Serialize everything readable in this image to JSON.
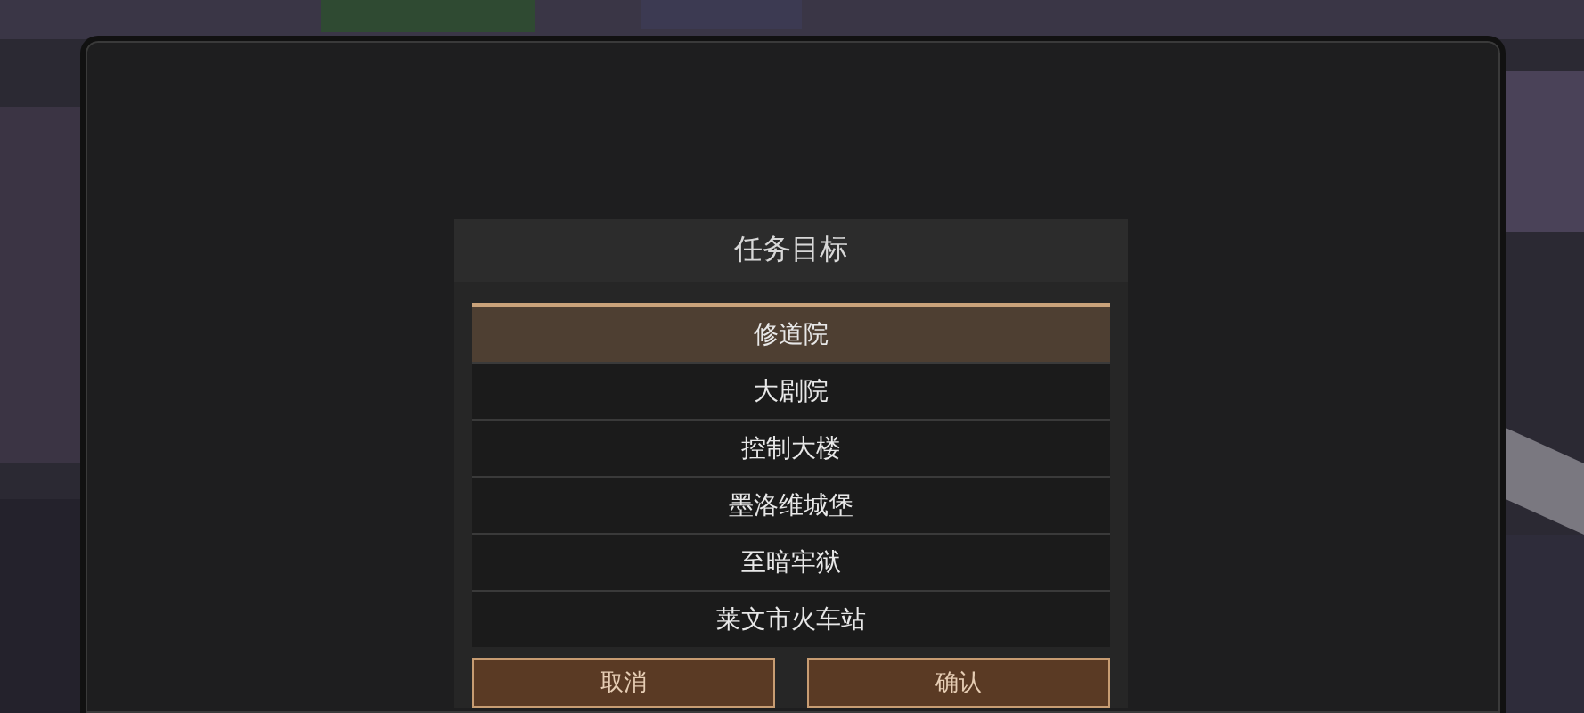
{
  "dialog": {
    "title": "任务目标",
    "options": [
      {
        "label": "修道院",
        "selected": true
      },
      {
        "label": "大剧院",
        "selected": false
      },
      {
        "label": "控制大楼",
        "selected": false
      },
      {
        "label": "墨洛维城堡",
        "selected": false
      },
      {
        "label": "至暗牢狱",
        "selected": false
      },
      {
        "label": "莱文市火车站",
        "selected": false
      }
    ],
    "buttons": [
      {
        "label": "取消"
      },
      {
        "label": "确认"
      }
    ]
  }
}
